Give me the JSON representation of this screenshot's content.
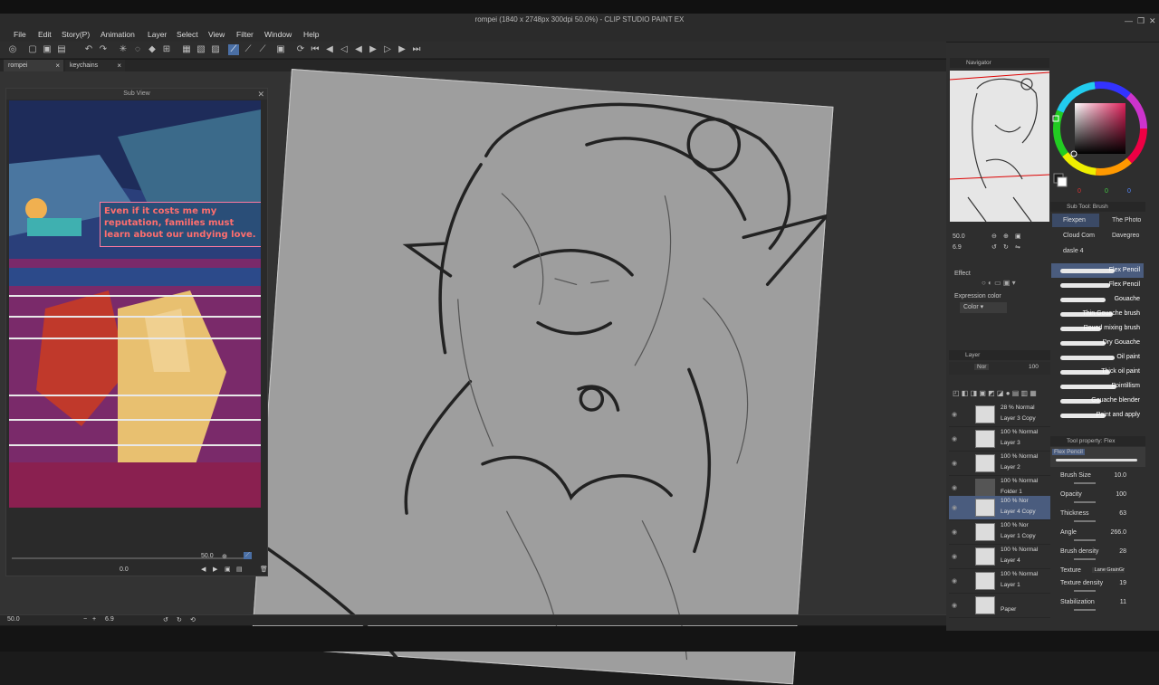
{
  "app": {
    "title": "rompei (1840 x 2748px 300dpi 50.0%) - CLIP STUDIO PAINT EX",
    "window_controls": [
      "minimize-icon",
      "maximize-icon",
      "close-icon"
    ]
  },
  "menu": [
    "File",
    "Edit",
    "Story(P)",
    "Animation",
    "Layer",
    "Select",
    "View",
    "Filter",
    "Window",
    "Help"
  ],
  "tabs": [
    {
      "label": "rompei",
      "close": "×"
    },
    {
      "label": "keychains",
      "close": "×"
    }
  ],
  "subview": {
    "title": "Sub View",
    "speech_bubble": "Even if it costs me my reputation, families must learn about our undying love.",
    "zoom": "50.0",
    "rotation": "0.0"
  },
  "statusbar": {
    "zoom": "50.0",
    "angle": "6.9"
  },
  "navigator": {
    "title": "Navigator",
    "zoom": "50.0",
    "angle": "6.9"
  },
  "color": {
    "fg": "#c8455f",
    "values": [
      "0",
      "0",
      "0"
    ]
  },
  "subtool": {
    "title": "Sub Tool: Brush",
    "groups": [
      "Flexpen",
      "The Photo",
      "Cloud Com",
      "Davegreo",
      "dasle 4"
    ],
    "brushes": [
      "Flex Pencil",
      "Flex Pencil",
      "Gouache",
      "Thin Gouache brush",
      "Round mixing brush",
      "Dry Gouache",
      "Oil paint",
      "Thick oil paint",
      "Pointillism",
      "Gouache blender",
      "Paint and apply"
    ]
  },
  "effect": {
    "label": "Effect",
    "expression_label": "Expression color",
    "expression_value": "Color"
  },
  "layers": {
    "title": "Layer",
    "blend": "Nor",
    "opacity": "100",
    "rows": [
      {
        "mode": "28 % Normal",
        "name": "Layer 3 Copy",
        "selected": false
      },
      {
        "mode": "100 % Normal",
        "name": "Layer 3",
        "selected": false
      },
      {
        "mode": "100 % Normal",
        "name": "Layer 2",
        "selected": false
      },
      {
        "mode": "100 % Normal",
        "name": "Folder 1",
        "selected": false
      },
      {
        "mode": "100 % Nor",
        "name": "Layer 4 Copy",
        "selected": true
      },
      {
        "mode": "100 % Nor",
        "name": "Layer 1 Copy",
        "selected": false
      },
      {
        "mode": "100 % Normal",
        "name": "Layer 4",
        "selected": false
      },
      {
        "mode": "100 % Normal",
        "name": "Layer 1",
        "selected": false
      },
      {
        "mode": "",
        "name": "Paper",
        "selected": false
      }
    ]
  },
  "toolprop": {
    "title": "Tool property: Flex",
    "preset": "Flex Pencil",
    "props": [
      {
        "label": "Brush Size",
        "value": "10.0"
      },
      {
        "label": "Opacity",
        "value": "100"
      },
      {
        "label": "Thickness",
        "value": "63"
      },
      {
        "label": "Angle",
        "value": "266.0"
      },
      {
        "label": "Brush density",
        "value": "28"
      },
      {
        "label": "Texture",
        "value": "Lane GrainGr"
      },
      {
        "label": "Texture density",
        "value": "19"
      },
      {
        "label": "Stabilization",
        "value": "11"
      }
    ]
  }
}
